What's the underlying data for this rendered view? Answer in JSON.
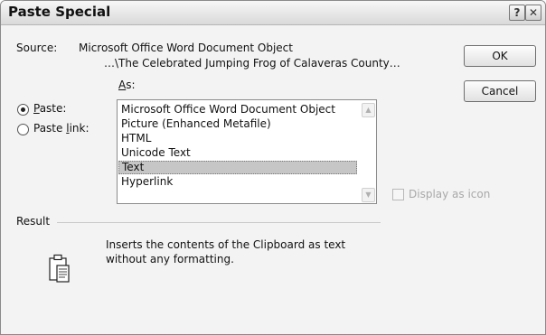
{
  "window": {
    "title": "Paste Special",
    "help_label": "?",
    "close_label": "✕"
  },
  "source": {
    "label": "Source:",
    "line1": "Microsoft Office Word Document Object",
    "line2": "…\\The Celebrated Jumping Frog of Calaveras County…"
  },
  "as_label": "As:",
  "options": {
    "paste": {
      "label": "Paste:",
      "selected": true
    },
    "paste_link": {
      "label": "Paste link:",
      "selected": false
    }
  },
  "formats": {
    "items": [
      "Microsoft Office Word Document Object",
      "Picture (Enhanced Metafile)",
      "HTML",
      "Unicode Text",
      "Text",
      "Hyperlink"
    ],
    "selected": "Text"
  },
  "display_as_icon": {
    "label": "Display as icon",
    "checked": false,
    "enabled": false
  },
  "buttons": {
    "ok": "OK",
    "cancel": "Cancel"
  },
  "result": {
    "label": "Result",
    "line1": "Inserts the contents of the Clipboard as text",
    "line2": "without any formatting.",
    "icon": "clipboard-icon"
  }
}
